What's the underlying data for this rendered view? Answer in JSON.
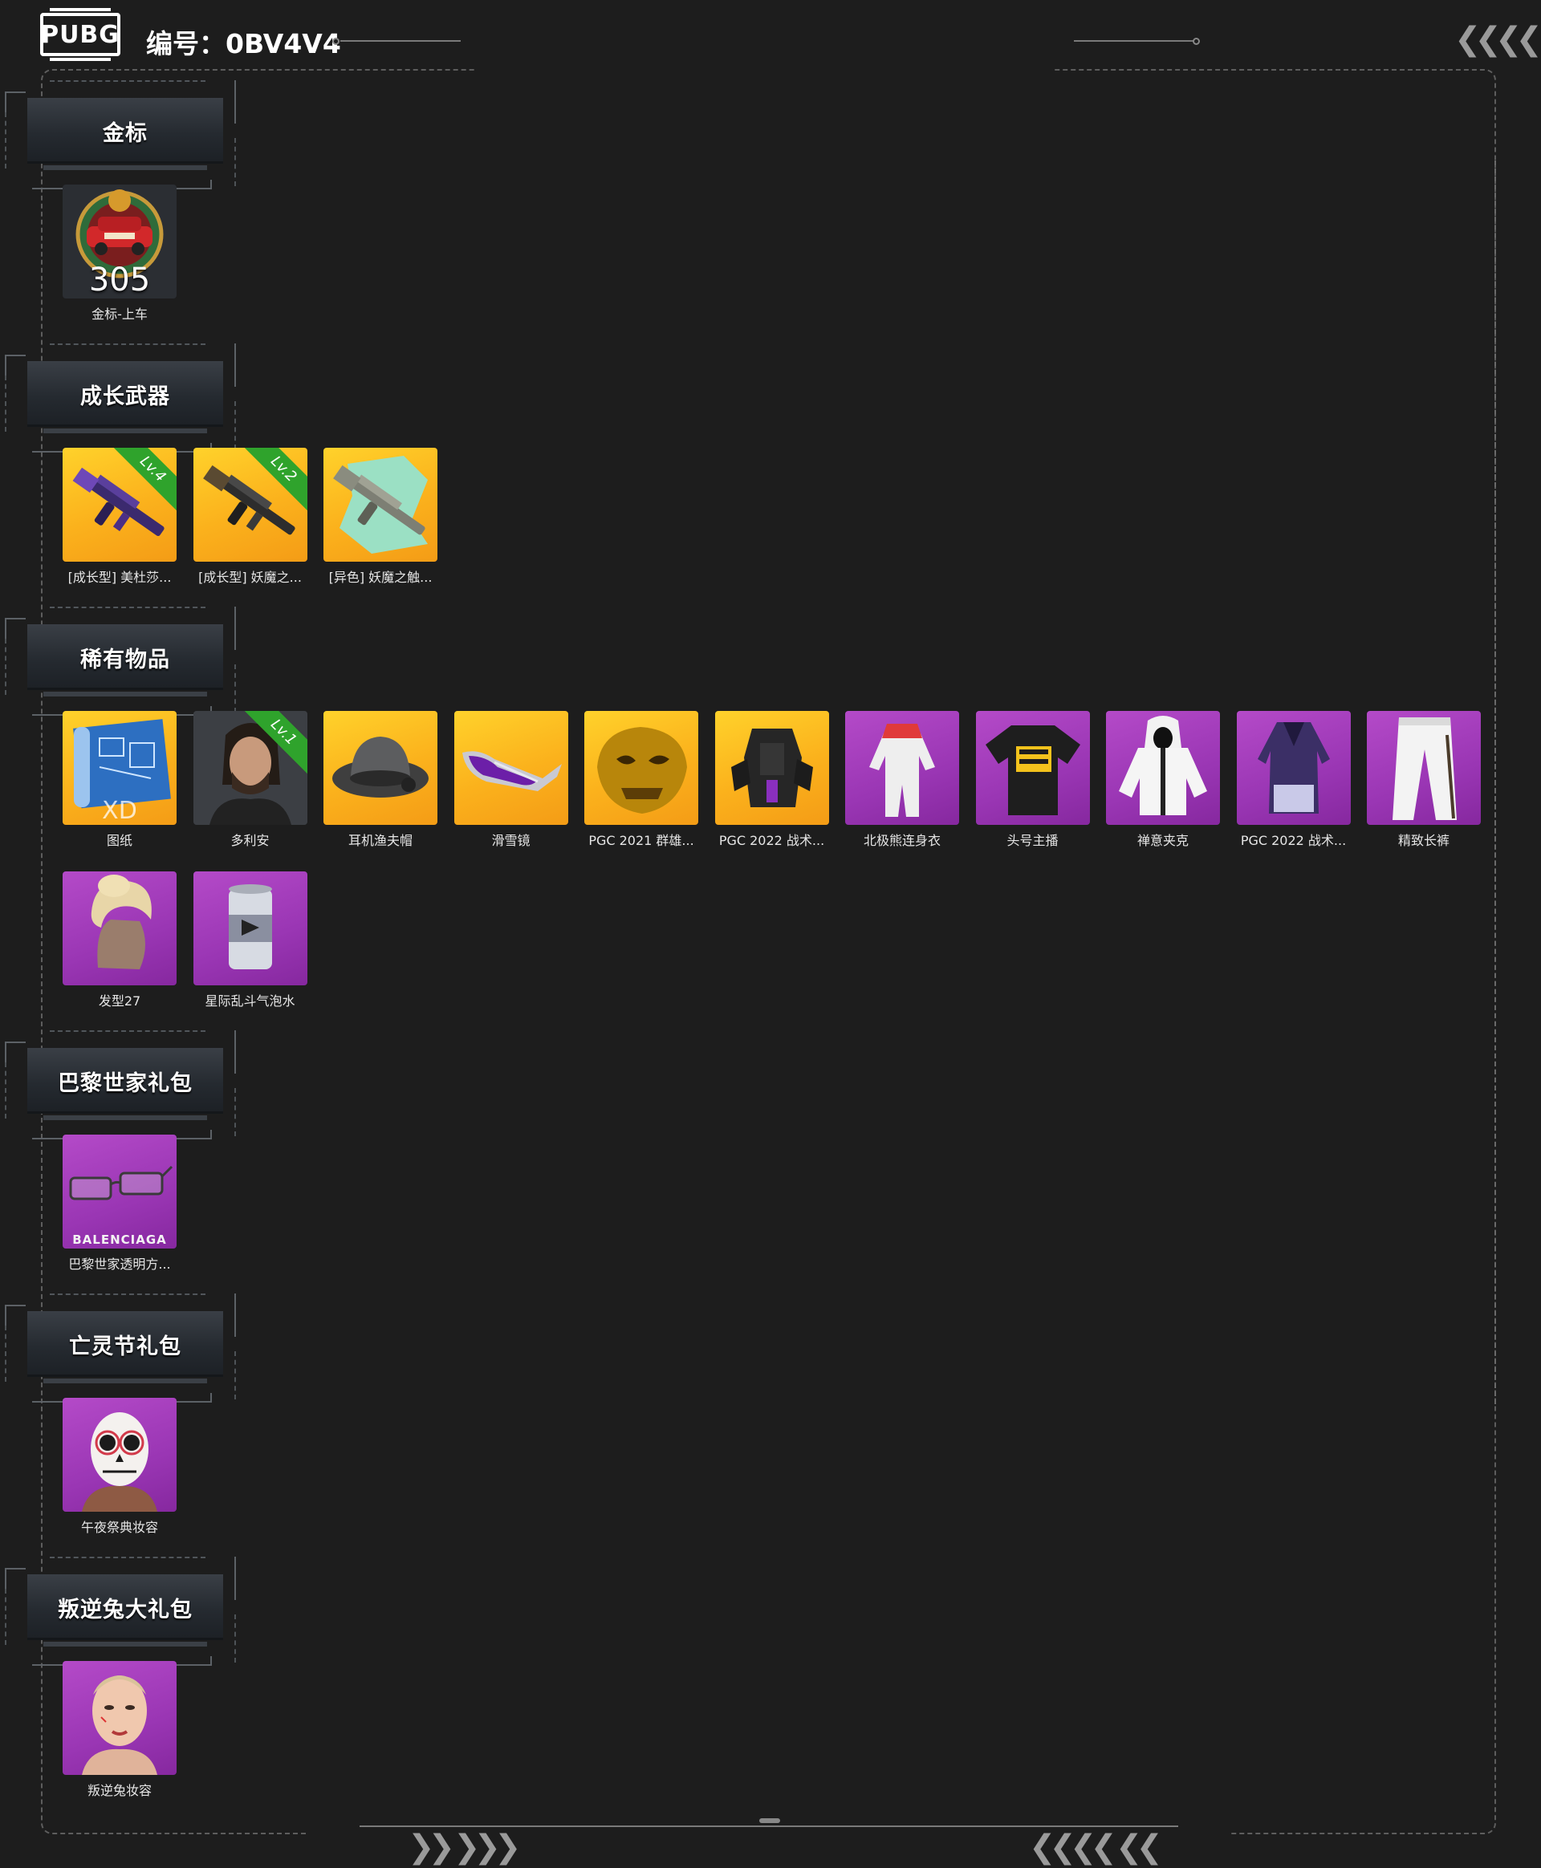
{
  "header": {
    "logo_text": "PUBG",
    "id_label": "编号：0BV4V4"
  },
  "sections": [
    {
      "title": "金标",
      "items": [
        {
          "name": "金标-上车",
          "bg": "dark",
          "icon": "gold-badge-car-icon",
          "overlay": "305"
        }
      ]
    },
    {
      "title": "成长武器",
      "items": [
        {
          "name": "[成长型] 美杜莎...",
          "bg": "gold",
          "icon": "purple-rifle-icon",
          "level": "Lv.4"
        },
        {
          "name": "[成长型] 妖魔之...",
          "bg": "gold",
          "icon": "rifle-icon",
          "level": "Lv.2"
        },
        {
          "name": "[异色] 妖魔之触...",
          "bg": "gold",
          "icon": "camo-rifle-icon"
        }
      ]
    },
    {
      "title": "稀有物品",
      "items": [
        {
          "name": "图纸",
          "bg": "gold",
          "icon": "blueprint-icon",
          "overlay": "XD"
        },
        {
          "name": "多利安",
          "bg": "dark",
          "icon": "character-portrait-icon",
          "level": "Lv.1"
        },
        {
          "name": "耳机渔夫帽",
          "bg": "gold",
          "icon": "bucket-hat-icon"
        },
        {
          "name": "滑雪镜",
          "bg": "gold",
          "icon": "ski-goggles-icon"
        },
        {
          "name": "PGC 2021 群雄...",
          "bg": "gold",
          "icon": "gold-mask-icon"
        },
        {
          "name": "PGC 2022 战术...",
          "bg": "gold",
          "icon": "tactical-vest-icon"
        },
        {
          "name": "北极熊连身衣",
          "bg": "purple",
          "icon": "jumpsuit-icon"
        },
        {
          "name": "头号主播",
          "bg": "purple",
          "icon": "tshirt-icon"
        },
        {
          "name": "禅意夹克",
          "bg": "purple",
          "icon": "hooded-jacket-icon"
        },
        {
          "name": "PGC 2022 战术...",
          "bg": "purple",
          "icon": "coat-icon"
        },
        {
          "name": "精致长裤",
          "bg": "purple",
          "icon": "pants-icon"
        },
        {
          "name": "发型27",
          "bg": "purple",
          "icon": "hairstyle-icon"
        },
        {
          "name": "星际乱斗气泡水",
          "bg": "purple",
          "icon": "soda-can-icon"
        }
      ]
    },
    {
      "title": "巴黎世家礼包",
      "items": [
        {
          "name": "巴黎世家透明方...",
          "bg": "purple",
          "icon": "glasses-icon",
          "overlay": "BALENCIAGA"
        }
      ]
    },
    {
      "title": "亡灵节礼包",
      "items": [
        {
          "name": "午夜祭典妆容",
          "bg": "purple",
          "icon": "skull-makeup-face-icon"
        }
      ]
    },
    {
      "title": "叛逆兔大礼包",
      "items": [
        {
          "name": "叛逆兔妆容",
          "bg": "purple",
          "icon": "face-makeup-icon"
        }
      ]
    }
  ]
}
